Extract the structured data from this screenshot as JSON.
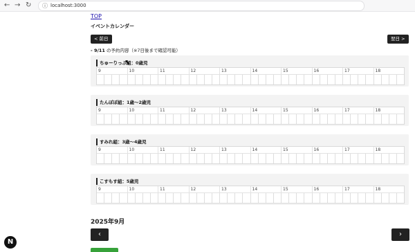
{
  "browser": {
    "back_icon": "arrow-left-icon",
    "forward_icon": "arrow-right-icon",
    "reload_icon": "reload-icon",
    "url": "localhost:3000"
  },
  "header": {
    "top_link": "TOP",
    "title": "イベントカレンダー",
    "prev_button": "< 前日",
    "next_button": "翌日 >"
  },
  "notice": {
    "date": "- 9/11",
    "text": " の予約内容（※7日後まで確認可能）"
  },
  "hours": [
    "9",
    "10",
    "11",
    "12",
    "13",
    "14",
    "15",
    "16",
    "17",
    "18"
  ],
  "classes": [
    {
      "title": "ちゅーりっぷ組：0歳児"
    },
    {
      "title": "たんぽぽ組：1歳〜2歳児"
    },
    {
      "title": "すみれ組：3歳〜4歳児"
    },
    {
      "title": "こすもす組：5歳児"
    }
  ],
  "month": {
    "title": "2025年9月",
    "prev_icon": "chevron-left-icon",
    "next_icon": "chevron-right-icon"
  },
  "floating": {
    "label": "N"
  }
}
